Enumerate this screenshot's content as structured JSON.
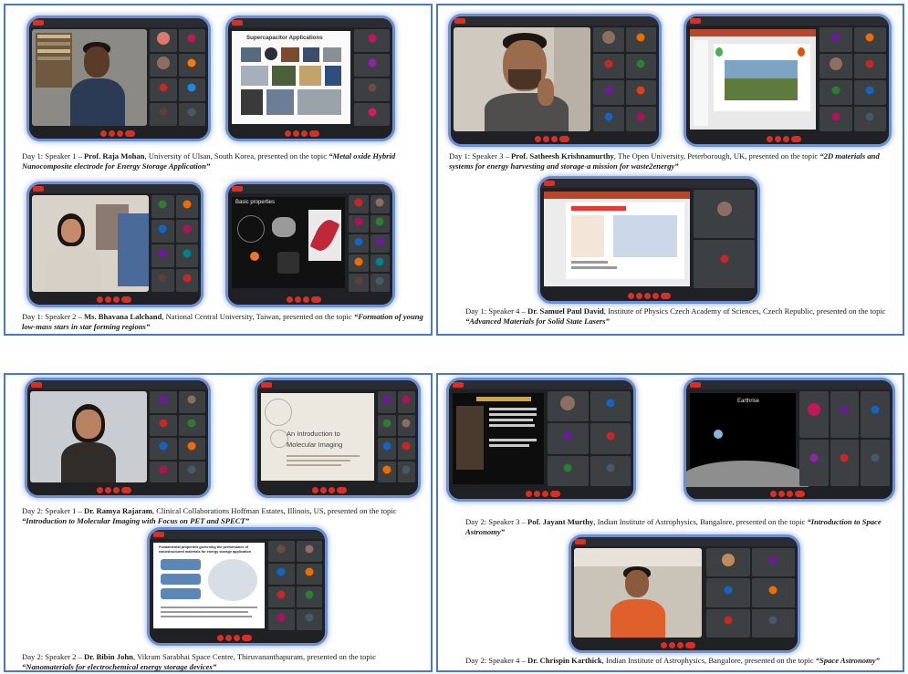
{
  "panels": {
    "p1": {
      "cap1": {
        "pre": "Day 1: Speaker 1 – ",
        "name": "Prof. Raja Mohan",
        "mid": ", University of Ulsan, South Korea, presented on the topic ",
        "topic": "“Metal oxide Hybrid Nanocomposite electrode for Energy Storage Application”"
      },
      "cap2": {
        "pre": "Day 1: Speaker 2 – ",
        "name": "Ms. Bhavana Lalchand",
        "mid": ", National Central University, Taiwan, presented on the topic ",
        "topic": "“Formation of young low-mass stars in star forming regions”"
      }
    },
    "p2": {
      "cap1": {
        "pre": "Day 1: Speaker 3 – ",
        "name": "Prof. Satheesh Krishnamurthy",
        "mid": ", The Open University, Peterborough, UK, presented on the topic ",
        "topic": "“2D materials and systems for energy harvesting and storage-a mission for waste2energy”"
      },
      "cap2": {
        "pre": "Day 1: Speaker 4 – ",
        "name": "Dr. Samuel Paul David",
        "mid": ", Institute of Physics Czech Academy of Sciences, Czech Republic, presented on the topic ",
        "topic": "“Advanced Materials for Solid State Lasers”"
      }
    },
    "p3": {
      "cap1": {
        "pre": "Day 2: Speaker 1 – ",
        "name": "Dr. Ramya Rajaram",
        "mid": ", Clinical Collaborations Hoffman Estates, Illinois, US, presented on the topic ",
        "topic": "“Introduction to Molecular Imaging with Focus on PET and SPECT”"
      },
      "cap2": {
        "pre": "Day 2: Speaker 2 – ",
        "name": "Dr. Bibin John",
        "mid": ", Vikram Sarabhai Space Centre, Thiruvananthapuram, presented on the topic ",
        "topic": "“Nanomaterials for electrochemical energy storage devices”"
      }
    },
    "p4": {
      "cap1": {
        "pre": "Day 2: Speaker 3 – ",
        "name": "Pof. Jayant Murthy",
        "mid": ", Indian Institute of Astrophysics, Bangalore, presented on the topic ",
        "topic": "“Introduction to Space Astronomy”"
      },
      "cap2": {
        "pre": "Day 2: Speaker 4 – ",
        "name": "Dr. Chrispin Karthick",
        "mid": ", Indian Institute of Astrophysics, Bangalore, presented on the topic ",
        "topic": "“Space Astronomy”"
      }
    }
  },
  "slides": {
    "supercap": "Supercapacitor Applications",
    "basic": "Basic properties",
    "imaging1": "An Introduction to",
    "imaging2": "Molecular Imaging",
    "earthrise": "Earthrise",
    "nano_title": "Fundamental properties governing the performance of nanostructured materials for energy storage application"
  },
  "colors": {
    "frame": "#4a79c4",
    "glow": "#6d8ecf",
    "meet_bg": "#1f2125",
    "end_call": "#d93025"
  }
}
